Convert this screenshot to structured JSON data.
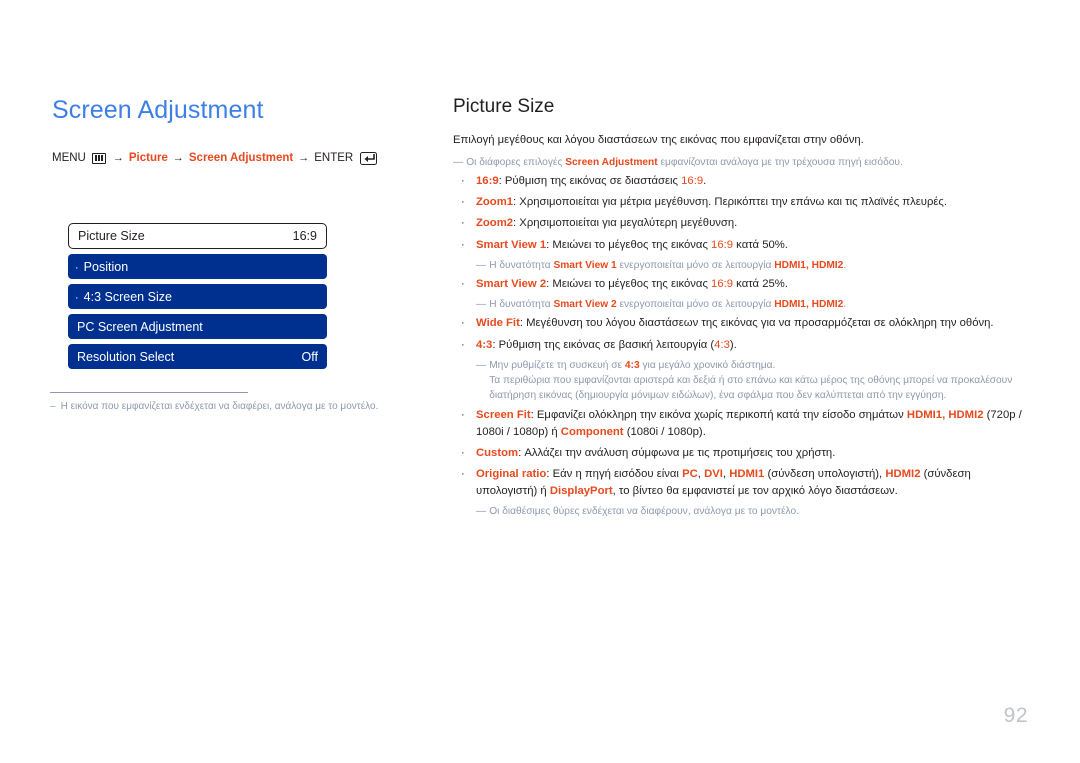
{
  "page": {
    "number": "92",
    "heading": "Screen Adjustment"
  },
  "breadcrumb": {
    "menu_label": "MENU",
    "menu_icon": "menu-bars-icon",
    "arrow": "→",
    "picture_label": "Picture",
    "screen_adjustment_label": "Screen Adjustment",
    "enter_label": "ENTER",
    "enter_icon": "enter-return-icon"
  },
  "osd": {
    "rows": [
      {
        "label": "Picture Size",
        "value": "16:9",
        "style": "head",
        "bullet": ""
      },
      {
        "label": "Position",
        "value": "",
        "style": "item",
        "bullet": "·"
      },
      {
        "label": "4:3 Screen Size",
        "value": "",
        "style": "item",
        "bullet": "·"
      },
      {
        "label": "PC Screen Adjustment",
        "value": "",
        "style": "item",
        "bullet": ""
      },
      {
        "label": "Resolution Select",
        "value": "Off",
        "style": "item",
        "bullet": ""
      }
    ]
  },
  "left_note": {
    "dash": "‒",
    "text": "Η εικόνα που εμφανίζεται ενδέχεται να διαφέρει, ανάλογα με το μοντέλο."
  },
  "section": {
    "title": "Picture Size",
    "lede": "Επιλογή μεγέθους και λόγου διαστάσεων της εικόνας που εμφανίζεται στην οθόνη.",
    "note_top": {
      "dash": "―",
      "pre": "Οι διάφορες επιλογές ",
      "term": "Screen Adjustment",
      "post": " εμφανίζονται ανάλογα με την τρέχουσα πηγή εισόδου."
    },
    "bullet_char": "·",
    "items": {
      "b1": {
        "term": "16:9",
        "text_a": ": Ρύθμιση της εικόνας σε διαστάσεις ",
        "term_b": "16:9",
        "text_b": "."
      },
      "b2": {
        "term": "Zoom1",
        "text_a": ": Χρησιμοποιείται για μέτρια μεγέθυνση. Περικόπτει την επάνω και τις πλαϊνές πλευρές."
      },
      "b3": {
        "term": "Zoom2",
        "text_a": ": Χρησιμοποιείται για μεγαλύτερη μεγέθυνση."
      },
      "b4": {
        "term": "Smart View 1",
        "text_a": ": Μειώνει το μέγεθος της εικόνας ",
        "term_b": "16:9",
        "text_b": " κατά 50%."
      },
      "n4": {
        "dash": "―",
        "pre": "Η δυνατότητα ",
        "term": "Smart View 1",
        "mid": " ενεργοποιείται μόνο σε λειτουργία ",
        "term_b": "HDMI1, HDMI2",
        "post": "."
      },
      "b5": {
        "term": "Smart View 2",
        "text_a": ": Μειώνει το μέγεθος της εικόνας ",
        "term_b": "16:9",
        "text_b": " κατά 25%."
      },
      "n5": {
        "dash": "―",
        "pre": "Η δυνατότητα ",
        "term": "Smart View 2",
        "mid": " ενεργοποιείται μόνο σε λειτουργία ",
        "term_b": "HDMI1, HDMI2",
        "post": "."
      },
      "b6": {
        "term": "Wide Fit",
        "text_a": ": Μεγέθυνση του λόγου διαστάσεων της εικόνας για να προσαρμόζεται σε ολόκληρη την οθόνη."
      },
      "b7": {
        "term": "4:3",
        "text_a": ": Ρύθμιση της εικόνας σε βασική λειτουργία (",
        "term_b": "4:3",
        "text_b": ")."
      },
      "n7": {
        "dash": "―",
        "pre": "Μην ρυθμίζετε τη συσκευή σε ",
        "term": "4:3",
        "post": " για μεγάλο χρονικό διάστημα.",
        "body": "Τα περιθώρια που εμφανίζονται αριστερά και δεξιά ή στο επάνω και κάτω μέρος της οθόνης μπορεί να προκαλέσουν διατήρηση εικόνας (δημιουργία μόνιμων ειδώλων), ένα σφάλμα που δεν καλύπτεται από την εγγύηση."
      },
      "b8": {
        "term": "Screen Fit",
        "text_a": ": Εμφανίζει ολόκληρη την εικόνα χωρίς περικοπή κατά την είσοδο σημάτων ",
        "term_b": "HDMI1, HDMI2",
        "text_b": " (720p / 1080i / 1080p) ή ",
        "term_c": "Component",
        "text_c": " (1080i / 1080p)."
      },
      "b9": {
        "term": "Custom",
        "text_a": ": Αλλάζει την ανάλυση σύμφωνα με τις προτιμήσεις του χρήστη."
      },
      "b10": {
        "term": "Original ratio",
        "text_a": ": Εάν η πηγή εισόδου είναι ",
        "term_b": "PC",
        "sep_b": ", ",
        "term_c": "DVI",
        "sep_c": ", ",
        "term_d": "HDMI1",
        "text_d": " (σύνδεση υπολογιστή), ",
        "term_e": "HDMI2",
        "text_e": " (σύνδεση υπολογιστή) ή ",
        "term_f": "DisplayPort",
        "text_f": ", το βίντεο θα εμφανιστεί με τον αρχικό λόγο διαστάσεων."
      },
      "n10": {
        "dash": "―",
        "text": "Οι διαθέσιμες θύρες ενδέχεται να διαφέρουν, ανάλογα με το μοντέλο."
      }
    }
  },
  "colors": {
    "heading_blue": "#3d7fe6",
    "osd_blue": "#00308f",
    "accent_red": "#e8491d",
    "note_gray": "#8e99ad",
    "page_gray": "#bfc4cc"
  }
}
